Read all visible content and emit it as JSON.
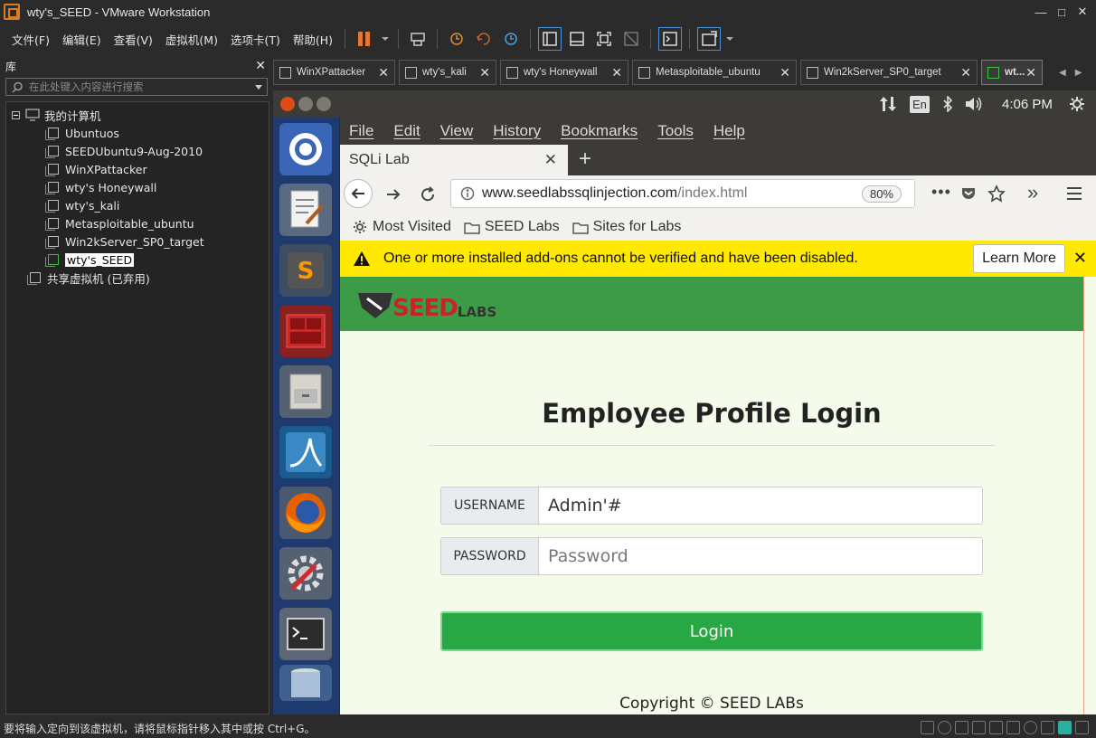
{
  "window": {
    "title": "wty's_SEED - VMware Workstation",
    "controls": [
      "—",
      "□",
      "✕"
    ]
  },
  "menu": [
    "文件(F)",
    "编辑(E)",
    "查看(V)",
    "虚拟机(M)",
    "选项卡(T)",
    "帮助(H)"
  ],
  "library": {
    "title": "库",
    "search_placeholder": "在此处键入内容进行搜索",
    "root": "我的计算机",
    "vms": [
      "Ubuntuos",
      "SEEDUbuntu9-Aug-2010",
      "WinXPattacker",
      "wty's Honeywall",
      "wty's_kali",
      "Metasploitable_ubuntu",
      "Win2kServer_SP0_target",
      "wty's_SEED"
    ],
    "shared": "共享虚拟机 (已弃用)"
  },
  "vm_tabs": [
    "WinXPattacker",
    "wty's_kali",
    "wty's Honeywall",
    "Metasploitable_ubuntu",
    "Win2kServer_SP0_target",
    "wt..."
  ],
  "ubuntu_panel": {
    "lang": "En",
    "time": "4:06 PM"
  },
  "firefox": {
    "menu": [
      "File",
      "Edit",
      "View",
      "History",
      "Bookmarks",
      "Tools",
      "Help"
    ],
    "tab_title": "SQLi Lab",
    "url_domain": "www.seedlabssqlinjection.com",
    "url_path": "/index.html",
    "zoom": "80%",
    "bookmarks": [
      "Most Visited",
      "SEED Labs",
      "Sites for Labs"
    ],
    "notification": "One or more installed add-ons cannot be verified and have been disabled.",
    "learn_more": "Learn More"
  },
  "page": {
    "logo_text_main": "SEED",
    "logo_text_sub": "LABS",
    "heading": "Employee Profile Login",
    "username_label": "USERNAME",
    "username_value": "Admin'#",
    "password_label": "PASSWORD",
    "password_placeholder": "Password",
    "login_button": "Login",
    "copyright": "Copyright © SEED LABs"
  },
  "status_text": "要将输入定向到该虚拟机，请将鼠标指针移入其中或按 Ctrl+G。",
  "colors": {
    "seed_header": "#3d9b47",
    "login_button": "#28a745",
    "notification": "#ffe900",
    "launcher": "#1f3a6e"
  }
}
